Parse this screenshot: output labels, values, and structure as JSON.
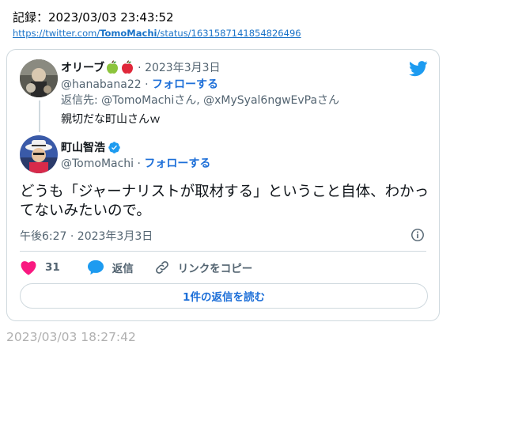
{
  "record": "記録：2023/03/03 23:43:52",
  "url": {
    "prefix": "https://twitter.com/",
    "user": "TomoMachi",
    "suffix": "/status/1631587141854826496"
  },
  "reply_tweet": {
    "name": "オリーブ",
    "date": "· 2023年3月3日",
    "handle": "@hanabana22",
    "follow": "フォローする",
    "reply_to": "返信先: @TomoMachiさん, @xMySyal6ngwEvPaさん",
    "text": "親切だな町山さんｗ"
  },
  "main_tweet": {
    "name": "町山智浩",
    "handle": "@TomoMachi",
    "follow": "フォローする",
    "text": "どうも「ジャーナリストが取材する」ということ自体、わかってないみたいので。",
    "time": "午後6:27 · 2023年3月3日"
  },
  "actions": {
    "likes": "31",
    "reply_label": "返信",
    "copy_link_label": "リンクをコピー"
  },
  "read_replies": "1件の返信を読む",
  "footer_time": "2023/03/03 18:27:42",
  "colors": {
    "accent": "#1d6fd8",
    "like": "#f91880",
    "twitter": "#1d9bf0"
  }
}
